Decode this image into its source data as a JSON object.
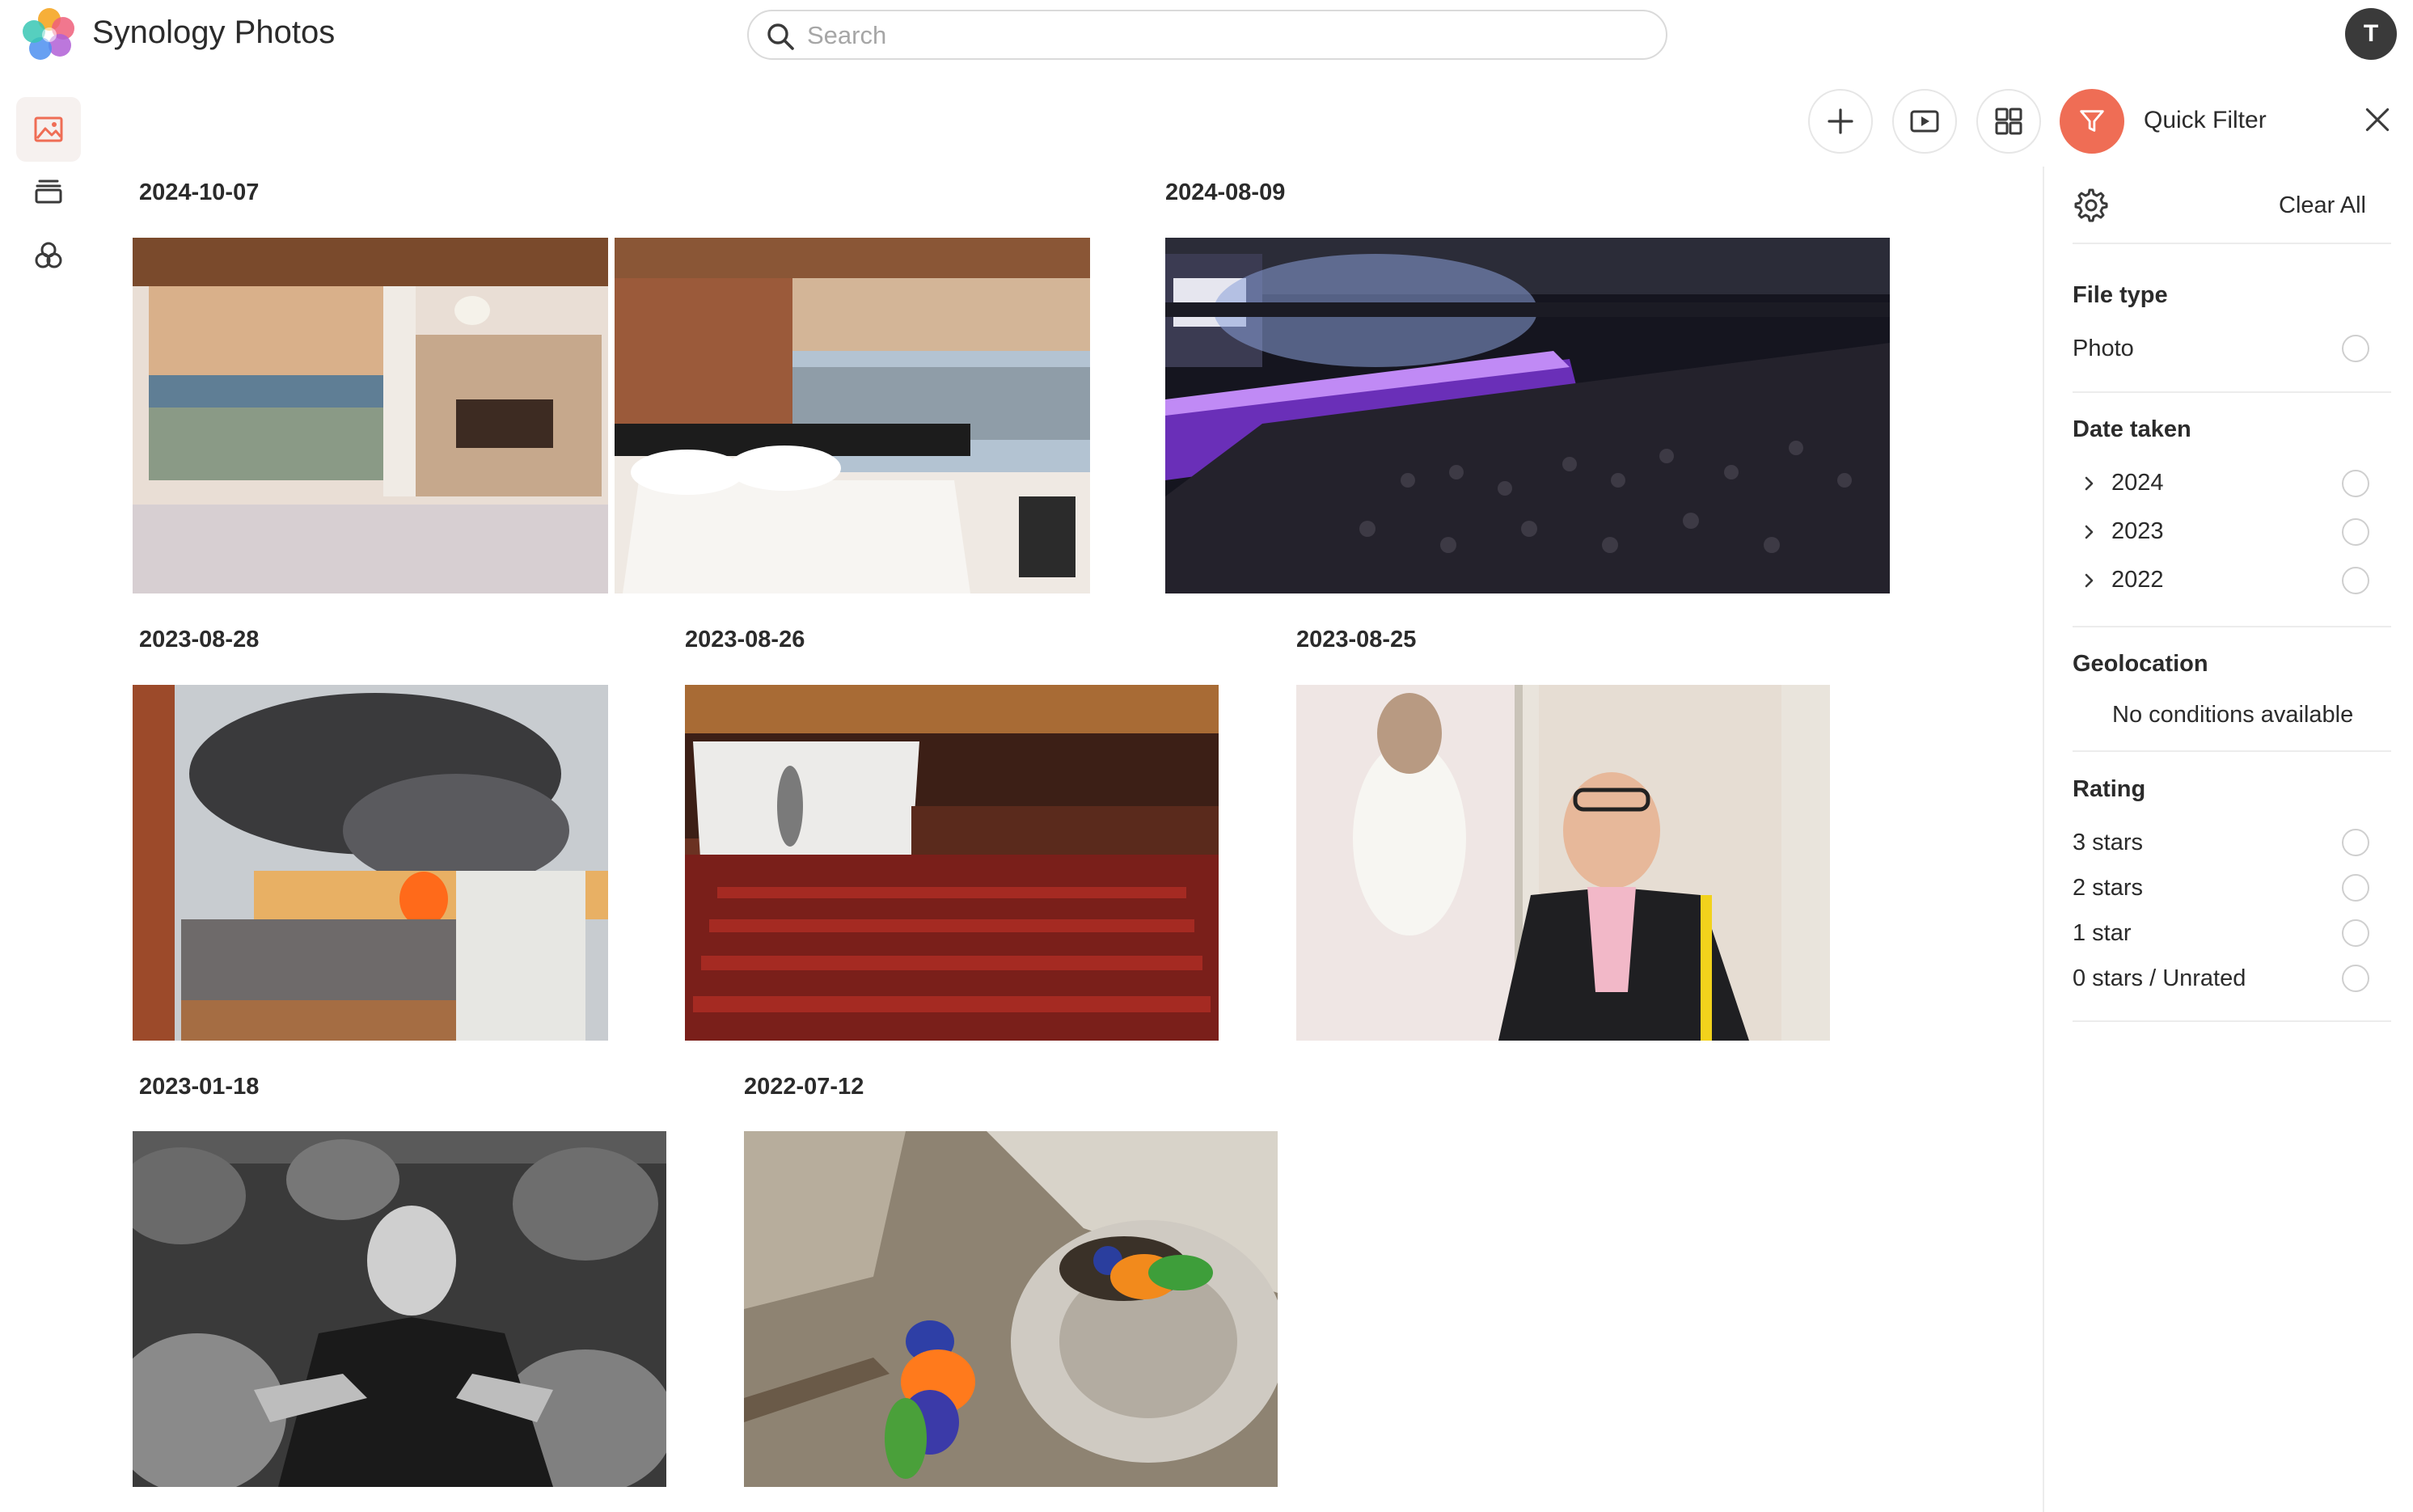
{
  "app": {
    "title": "Synology Photos"
  },
  "search": {
    "placeholder": "Search",
    "value": ""
  },
  "user": {
    "avatar_initial": "T"
  },
  "toolbar": {
    "quick_filter_label": "Quick Filter"
  },
  "timeline": [
    {
      "date": "2024-10-07",
      "photos": [
        "hotel-room-window",
        "hotel-bedroom"
      ]
    },
    {
      "date": "2024-08-09",
      "photos": [
        "concert-crowd"
      ]
    },
    {
      "date": "2023-08-28",
      "photos": [
        "city-fire-smoke"
      ]
    },
    {
      "date": "2023-08-26",
      "photos": [
        "cinema-hall"
      ]
    },
    {
      "date": "2023-08-25",
      "photos": [
        "man-at-gallery"
      ]
    },
    {
      "date": "2023-01-18",
      "photos": [
        "man-with-barrels"
      ]
    },
    {
      "date": "2022-07-12",
      "photos": [
        "lorikeets-on-tree"
      ]
    }
  ],
  "filter_panel": {
    "clear_all": "Clear All",
    "file_type": {
      "title": "File type",
      "options": [
        "Photo"
      ]
    },
    "date_taken": {
      "title": "Date taken",
      "options": [
        "2024",
        "2023",
        "2022"
      ]
    },
    "geolocation": {
      "title": "Geolocation",
      "empty": "No conditions available"
    },
    "rating": {
      "title": "Rating",
      "options": [
        "3 stars",
        "2 stars",
        "1 star",
        "0 stars / Unrated"
      ]
    }
  },
  "colors": {
    "accent": "#ef6d55",
    "nav_active_bg": "#f6f1ef"
  }
}
